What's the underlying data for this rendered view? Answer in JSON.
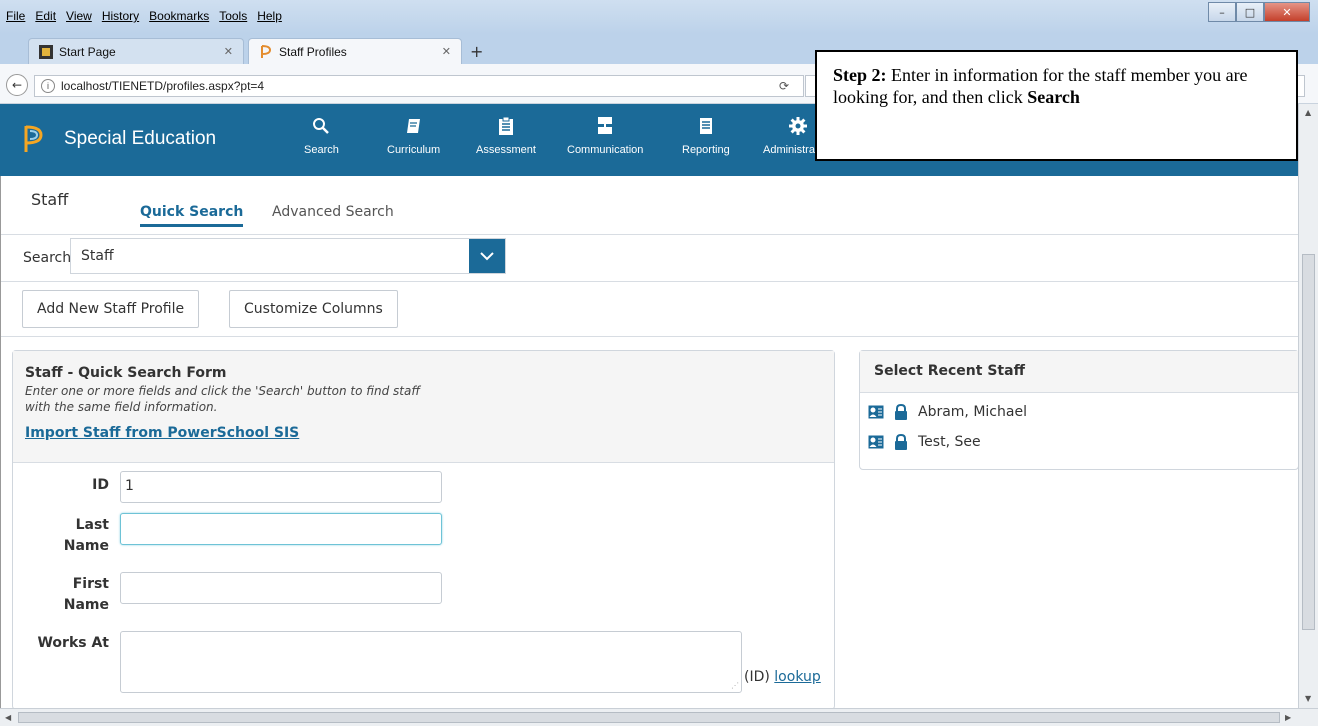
{
  "window": {
    "menu": [
      "File",
      "Edit",
      "View",
      "History",
      "Bookmarks",
      "Tools",
      "Help"
    ],
    "controls": {
      "minimize": "–",
      "maximize": "□",
      "close": "✕"
    }
  },
  "browser": {
    "tabs": [
      {
        "label": "Start Page",
        "active": false
      },
      {
        "label": "Staff Profiles",
        "active": true
      }
    ],
    "url": "localhost/TIENETD/profiles.aspx?pt=4"
  },
  "app": {
    "title": "Special Education",
    "nav": [
      {
        "label": "Search",
        "icon": "search-icon"
      },
      {
        "label": "Curriculum",
        "icon": "book-icon"
      },
      {
        "label": "Assessment",
        "icon": "clipboard-icon"
      },
      {
        "label": "Communication",
        "icon": "communication-icon"
      },
      {
        "label": "Reporting",
        "icon": "document-icon"
      },
      {
        "label": "Administration",
        "icon": "gear-icon"
      }
    ],
    "colors": {
      "brand": "#1b6a98"
    }
  },
  "page": {
    "title": "Staff",
    "tabs": [
      {
        "label": "Quick Search",
        "active": true
      },
      {
        "label": "Advanced Search",
        "active": false
      }
    ],
    "search_label": "Search:",
    "search_value": "Staff",
    "buttons": {
      "add_new": "Add New Staff Profile",
      "customize": "Customize Columns"
    }
  },
  "form": {
    "title": "Staff - Quick Search Form",
    "description": "Enter one or more fields and click the 'Search' button to find staff with the same field information.",
    "import_link": "Import Staff from PowerSchool SIS",
    "fields": {
      "id": {
        "label": "ID",
        "value": "1"
      },
      "last_name": {
        "label_1": "Last",
        "label_2": "Name",
        "value": ""
      },
      "first_name": {
        "label_1": "First",
        "label_2": "Name",
        "value": ""
      },
      "works_at": {
        "label": "Works At",
        "value": ""
      }
    },
    "lookup_prefix": "(ID)",
    "lookup_link": "lookup"
  },
  "recent": {
    "title": "Select Recent Staff",
    "items": [
      "Abram, Michael",
      "Test, See"
    ]
  },
  "callout": {
    "step": "Step 2:",
    "text": "Enter in information for the staff member you are looking for, and then click",
    "action": "Search"
  }
}
